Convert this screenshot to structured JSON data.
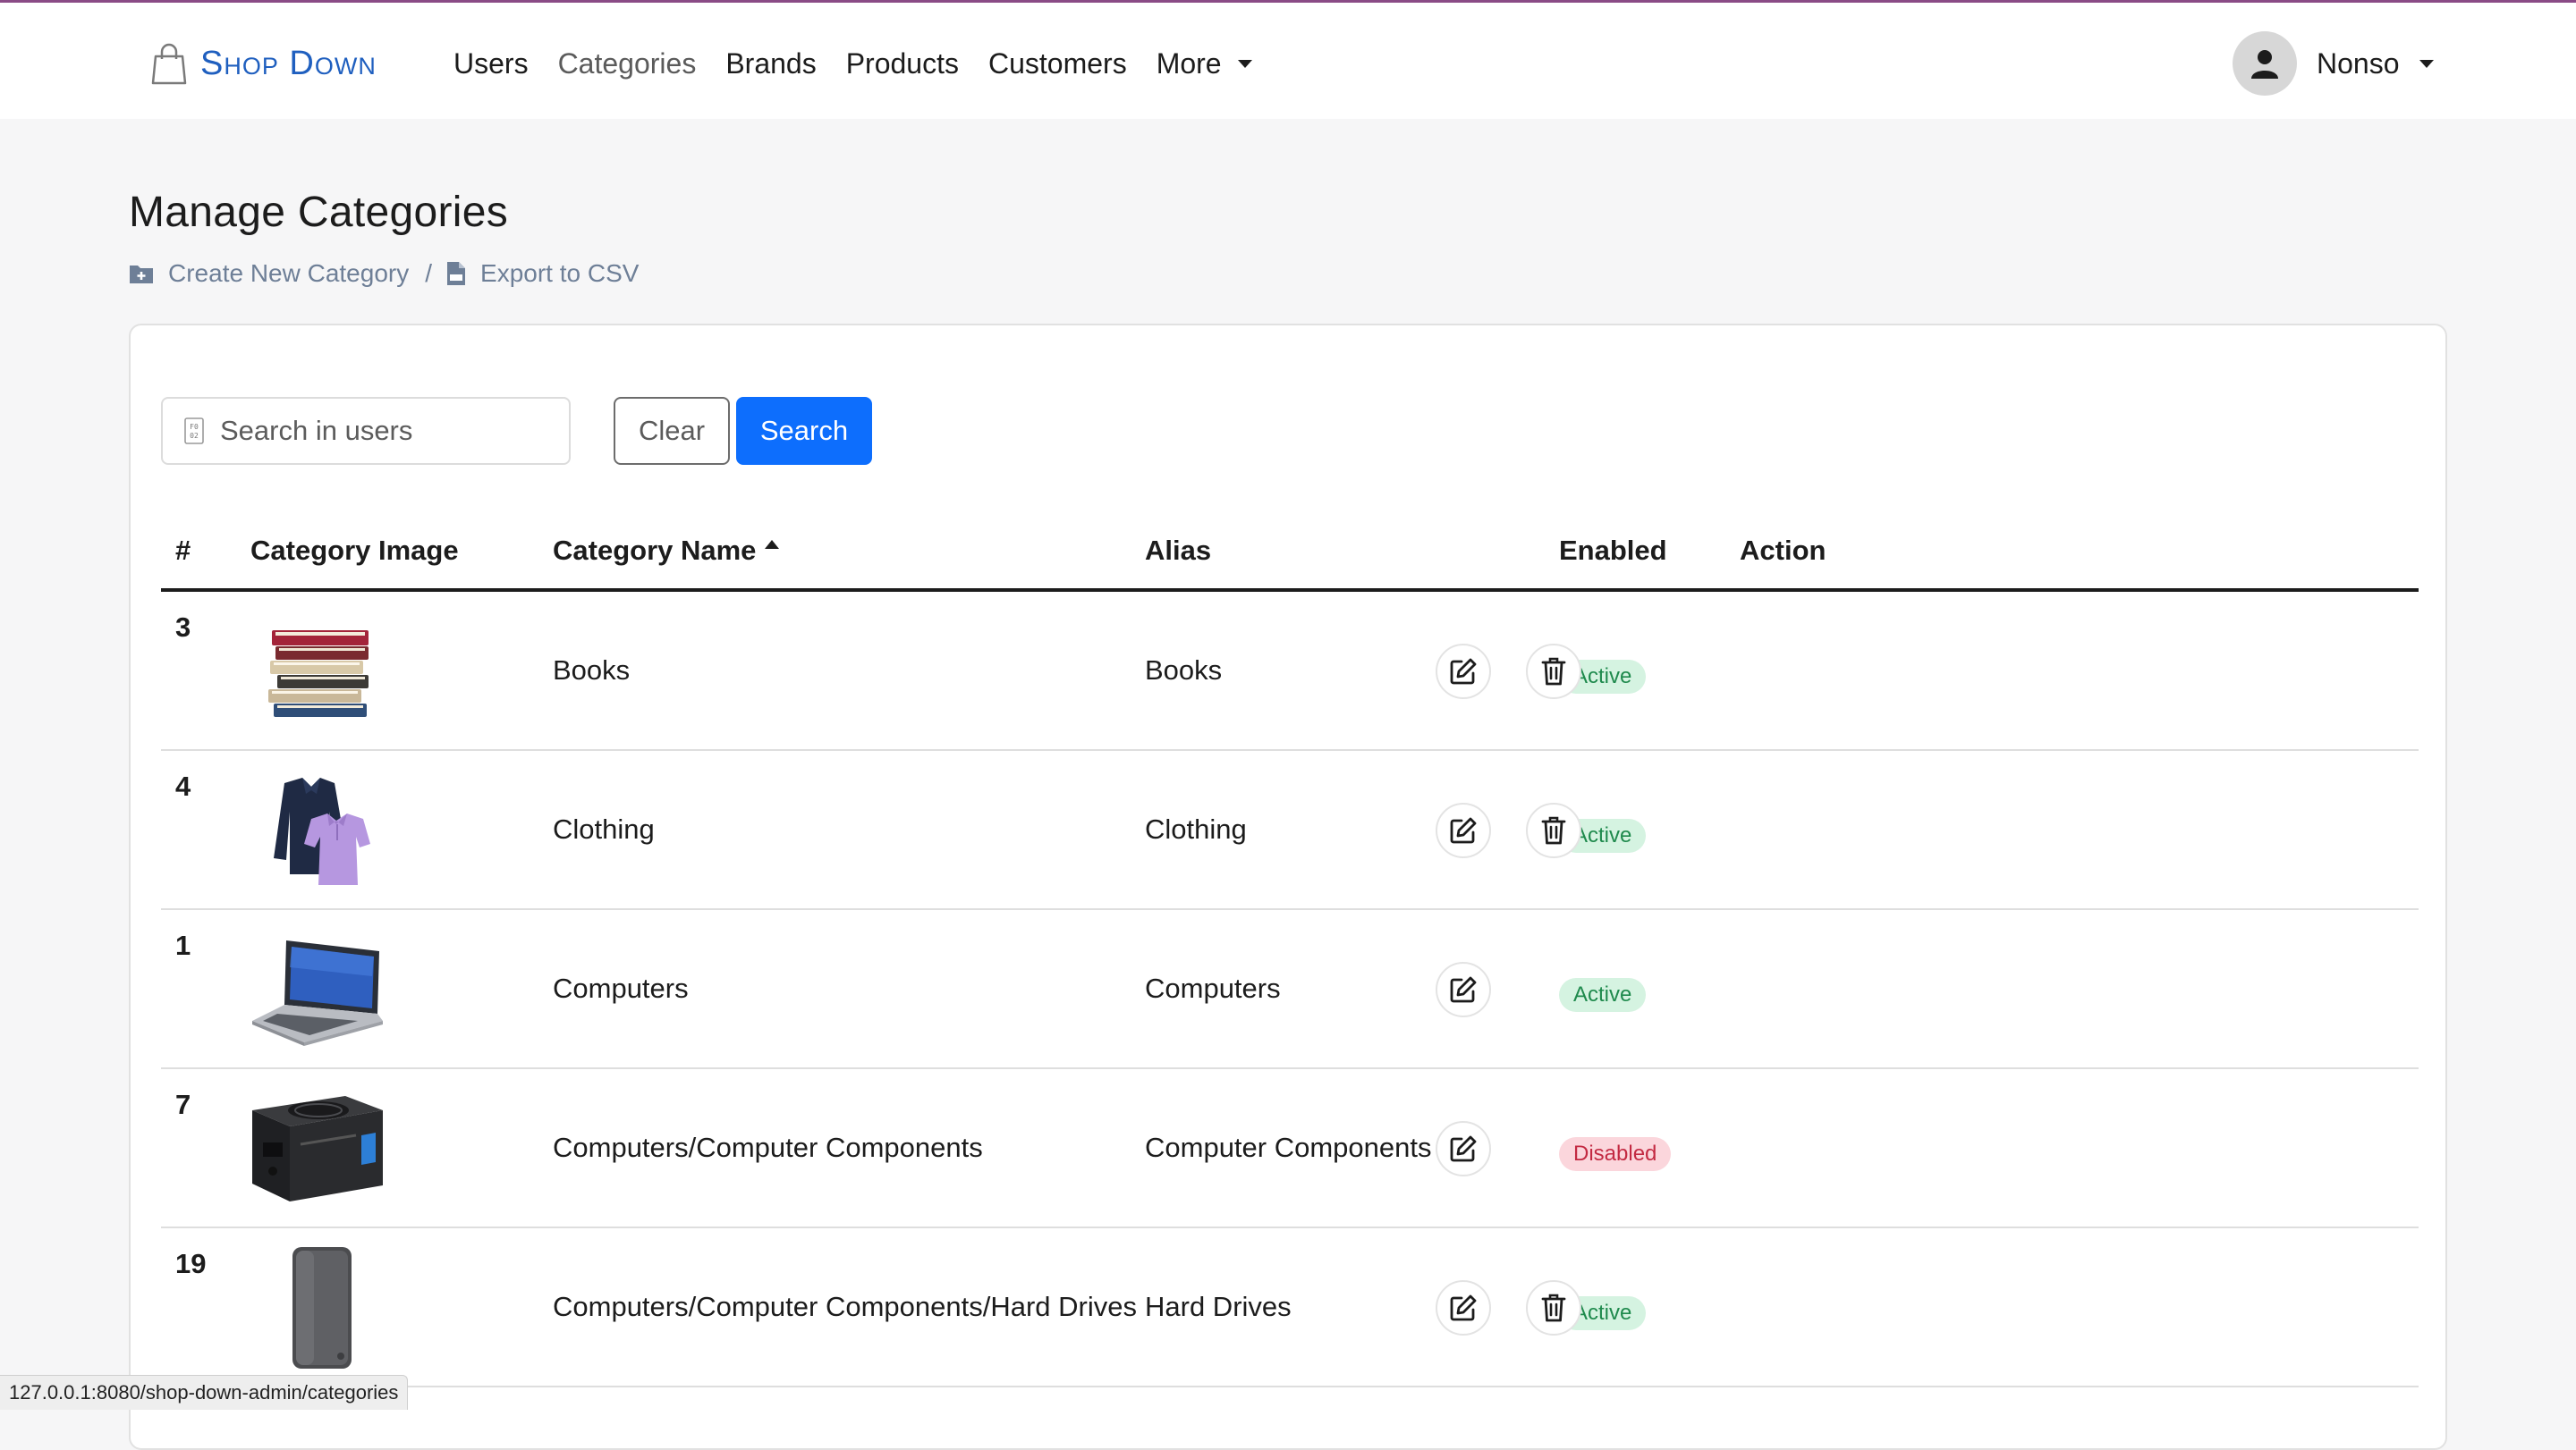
{
  "brand": {
    "name": "Shop Down",
    "icon": "shopping-bag-icon"
  },
  "nav": {
    "items": [
      {
        "label": "Users",
        "active": false
      },
      {
        "label": "Categories",
        "active": true
      },
      {
        "label": "Brands",
        "active": false
      },
      {
        "label": "Products",
        "active": false
      },
      {
        "label": "Customers",
        "active": false
      }
    ],
    "more_label": "More"
  },
  "user": {
    "name": "Nonso",
    "icon": "user-avatar-icon"
  },
  "page": {
    "title": "Manage Categories",
    "create_label": "Create New Category",
    "separator": "/",
    "export_label": "Export to CSV"
  },
  "search": {
    "placeholder": "Search in users",
    "value": "",
    "clear_label": "Clear",
    "search_label": "Search"
  },
  "table": {
    "headers": {
      "id": "#",
      "image": "Category Image",
      "name": "Category Name",
      "alias": "Alias",
      "enabled": "Enabled",
      "action": "Action"
    },
    "sort": {
      "column": "Category Name",
      "direction": "ascending"
    },
    "rows": [
      {
        "id": "3",
        "image": "books",
        "name": "Books",
        "alias": "Books",
        "status": "Active",
        "enabled": true,
        "can_delete": true
      },
      {
        "id": "4",
        "image": "clothing",
        "name": "Clothing",
        "alias": "Clothing",
        "status": "Active",
        "enabled": true,
        "can_delete": true
      },
      {
        "id": "1",
        "image": "laptop",
        "name": "Computers",
        "alias": "Computers",
        "status": "Active",
        "enabled": true,
        "can_delete": false
      },
      {
        "id": "7",
        "image": "power-supply",
        "name": "Computers/Computer Components",
        "alias": "Computer Components",
        "status": "Disabled",
        "enabled": false,
        "can_delete": false
      },
      {
        "id": "19",
        "image": "hard-drive",
        "name": "Computers/Computer Components/Hard Drives",
        "alias": "Hard Drives",
        "status": "Active",
        "enabled": true,
        "can_delete": true
      }
    ]
  },
  "statusbar": {
    "url": "127.0.0.1:8080/shop-down-admin/categories"
  },
  "colors": {
    "accent": "#0d6efd",
    "brand": "#1f5fbf",
    "active_badge_bg": "#d5f3e1",
    "active_badge_text": "#1f8a4d",
    "disabled_badge_bg": "#fbd6dc",
    "disabled_badge_text": "#c32a42"
  }
}
